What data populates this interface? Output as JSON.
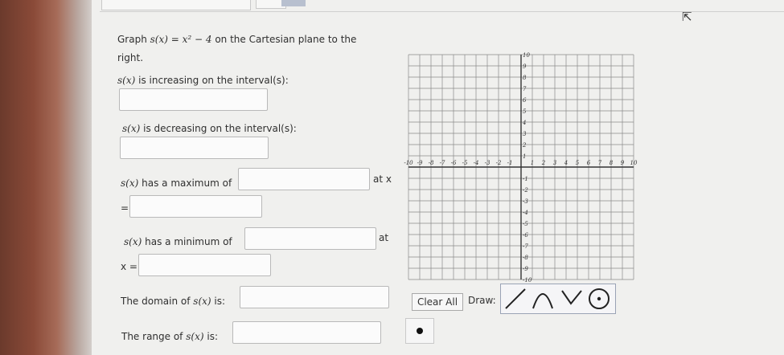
{
  "prompt": {
    "graph_prefix": "Graph",
    "function": "s(x) = x² − 4",
    "graph_suffix": "on the Cartesian plane to the",
    "graph_line2": "right."
  },
  "questions": {
    "increasing": {
      "func": "s(x)",
      "text": "is increasing on the interval(s):",
      "value": ""
    },
    "decreasing": {
      "func": "s(x)",
      "text": "is decreasing on the interval(s):",
      "value": ""
    },
    "maximum": {
      "func": "s(x)",
      "text": "has a maximum of",
      "at": "at x",
      "eq": "=",
      "value": "",
      "x_value": ""
    },
    "minimum": {
      "func": "s(x)",
      "text": "has a minimum of",
      "at": "at",
      "xeq": "x =",
      "value": "",
      "x_value": ""
    },
    "domain": {
      "prefix": "The domain of",
      "func": "s(x)",
      "suffix": "is:",
      "value": ""
    },
    "range": {
      "prefix": "The range of",
      "func": "s(x)",
      "suffix": "is:",
      "value": ""
    }
  },
  "graph": {
    "x_ticks": [
      "-10",
      "-9",
      "-8",
      "-7",
      "-6",
      "-5",
      "-4",
      "-3",
      "-2",
      "-1",
      "1",
      "2",
      "3",
      "4",
      "5",
      "6",
      "7",
      "8",
      "9",
      "10"
    ],
    "y_ticks": [
      "10",
      "9",
      "8",
      "7",
      "6",
      "5",
      "4",
      "3",
      "2",
      "1",
      "-1",
      "-2",
      "-3",
      "-4",
      "-5",
      "-6",
      "-7",
      "-8",
      "-9",
      "-10"
    ],
    "x_min": -10,
    "x_max": 10,
    "y_min": -10,
    "y_max": 10
  },
  "controls": {
    "clear_all": "Clear All",
    "draw_label": "Draw:",
    "tools": [
      "line-tool-icon",
      "parabola-up-icon",
      "parabola-down-icon",
      "point-circle-icon"
    ]
  },
  "colors": {
    "grid": "#8a8a8a",
    "axis": "#333333",
    "tool_border": "#9aa3b5"
  }
}
